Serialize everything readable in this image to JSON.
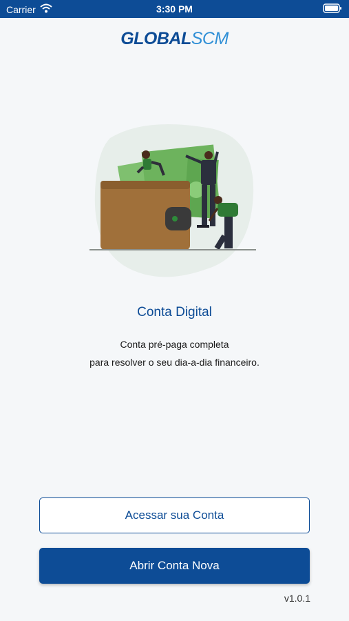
{
  "status_bar": {
    "carrier": "Carrier",
    "time": "3:30 PM"
  },
  "header": {
    "brand_part1": "GLOBAL",
    "brand_part2": "SCM"
  },
  "hero": {
    "title": "Conta Digital",
    "subtitle_line1": "Conta pré-paga completa",
    "subtitle_line2": "para resolver o seu dia-a-dia financeiro."
  },
  "actions": {
    "login_label": "Acessar sua Conta",
    "signup_label": "Abrir Conta Nova"
  },
  "footer": {
    "version": "v1.0.1"
  },
  "colors": {
    "primary": "#0d4c96",
    "accent": "#2f8fd6"
  }
}
